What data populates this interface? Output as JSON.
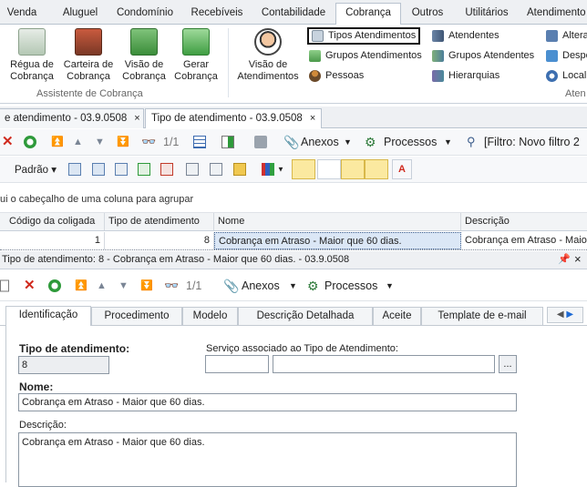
{
  "menu": {
    "tabs": [
      "Venda",
      "Aluguel",
      "Condomínio",
      "Recebíveis",
      "Contabilidade",
      "Cobrança",
      "Outros",
      "Utilitários",
      "Atendimento"
    ],
    "active": "Cobrança"
  },
  "ribbon": {
    "group1": {
      "buttons": [
        {
          "label": "Régua de Cobrança",
          "icon": "ruler-money-icon"
        },
        {
          "label": "Carteira de Cobrança",
          "icon": "wallet-icon"
        },
        {
          "label": "Visão de Cobrança",
          "icon": "money-view-icon"
        },
        {
          "label": "Gerar Cobrança",
          "icon": "generate-bill-icon"
        }
      ],
      "title": "Assistente de Cobrança"
    },
    "visao_atendimentos": {
      "label": "Visão de Atendimentos",
      "icon": "headset-icon"
    },
    "col1": [
      {
        "label": "Tipos Atendimentos",
        "icon": "service-type-icon"
      },
      {
        "label": "Grupos Atendimentos",
        "icon": "service-group-icon"
      },
      {
        "label": "Pessoas",
        "icon": "person-icon"
      }
    ],
    "col2": [
      {
        "label": "Atendentes",
        "icon": "attendants-icon"
      },
      {
        "label": "Grupos Atendentes",
        "icon": "attendant-groups-icon"
      },
      {
        "label": "Hierarquias",
        "icon": "hierarchy-icon"
      }
    ],
    "col3": [
      {
        "label": "Altera",
        "icon": "alter-icon"
      },
      {
        "label": "Despe",
        "icon": "expense-icon"
      },
      {
        "label": "Locali",
        "icon": "locate-icon"
      }
    ],
    "group2_title": "Aten"
  },
  "doc_tabs": [
    {
      "label": "e atendimento - 03.9.0508",
      "close": "×"
    },
    {
      "label": "Tipo de atendimento - 03.9.0508",
      "close": "×"
    }
  ],
  "toolbar1": {
    "page": "1/1",
    "anexos": "Anexos",
    "processos": "Processos",
    "filter": "[Filtro: Novo filtro 2"
  },
  "toolbar2": {
    "padrao": "Padrão"
  },
  "group_hint": "ui o cabeçalho de uma coluna para agrupar",
  "grid": {
    "columns": [
      "Código da coligada",
      "Tipo de atendimento",
      "Nome",
      "Descrição"
    ],
    "rows": [
      [
        "1",
        "8",
        "Cobrança em Atraso - Maior que 60 dias.",
        "Cobrança em Atraso - Maior"
      ]
    ]
  },
  "detail": {
    "title": "Tipo de atendimento: 8 - Cobrança em Atraso - Maior que 60 dias. - 03.9.0508",
    "pin": "📌",
    "close": "×",
    "page": "1/1",
    "anexos": "Anexos",
    "processos": "Processos",
    "tabs": [
      "Identificação",
      "Procedimento",
      "Modelo",
      "Descrição Detalhada",
      "Aceite",
      "Template de e-mail"
    ],
    "fields": {
      "tipo_label": "Tipo de atendimento:",
      "tipo_value": "8",
      "servico_label": "Serviço associado ao Tipo de Atendimento:",
      "servico_btn": "...",
      "nome_label": "Nome:",
      "nome_value": "Cobrança em Atraso - Maior que 60 dias.",
      "descricao_label": "Descrição:",
      "descricao_value": "Cobrança em Atraso - Maior que 60 dias."
    }
  },
  "colors": {
    "accent": "#1e6ad4",
    "green": "#2e9a3a",
    "red": "#d02a1e",
    "highlight": "#fbe9a0"
  }
}
